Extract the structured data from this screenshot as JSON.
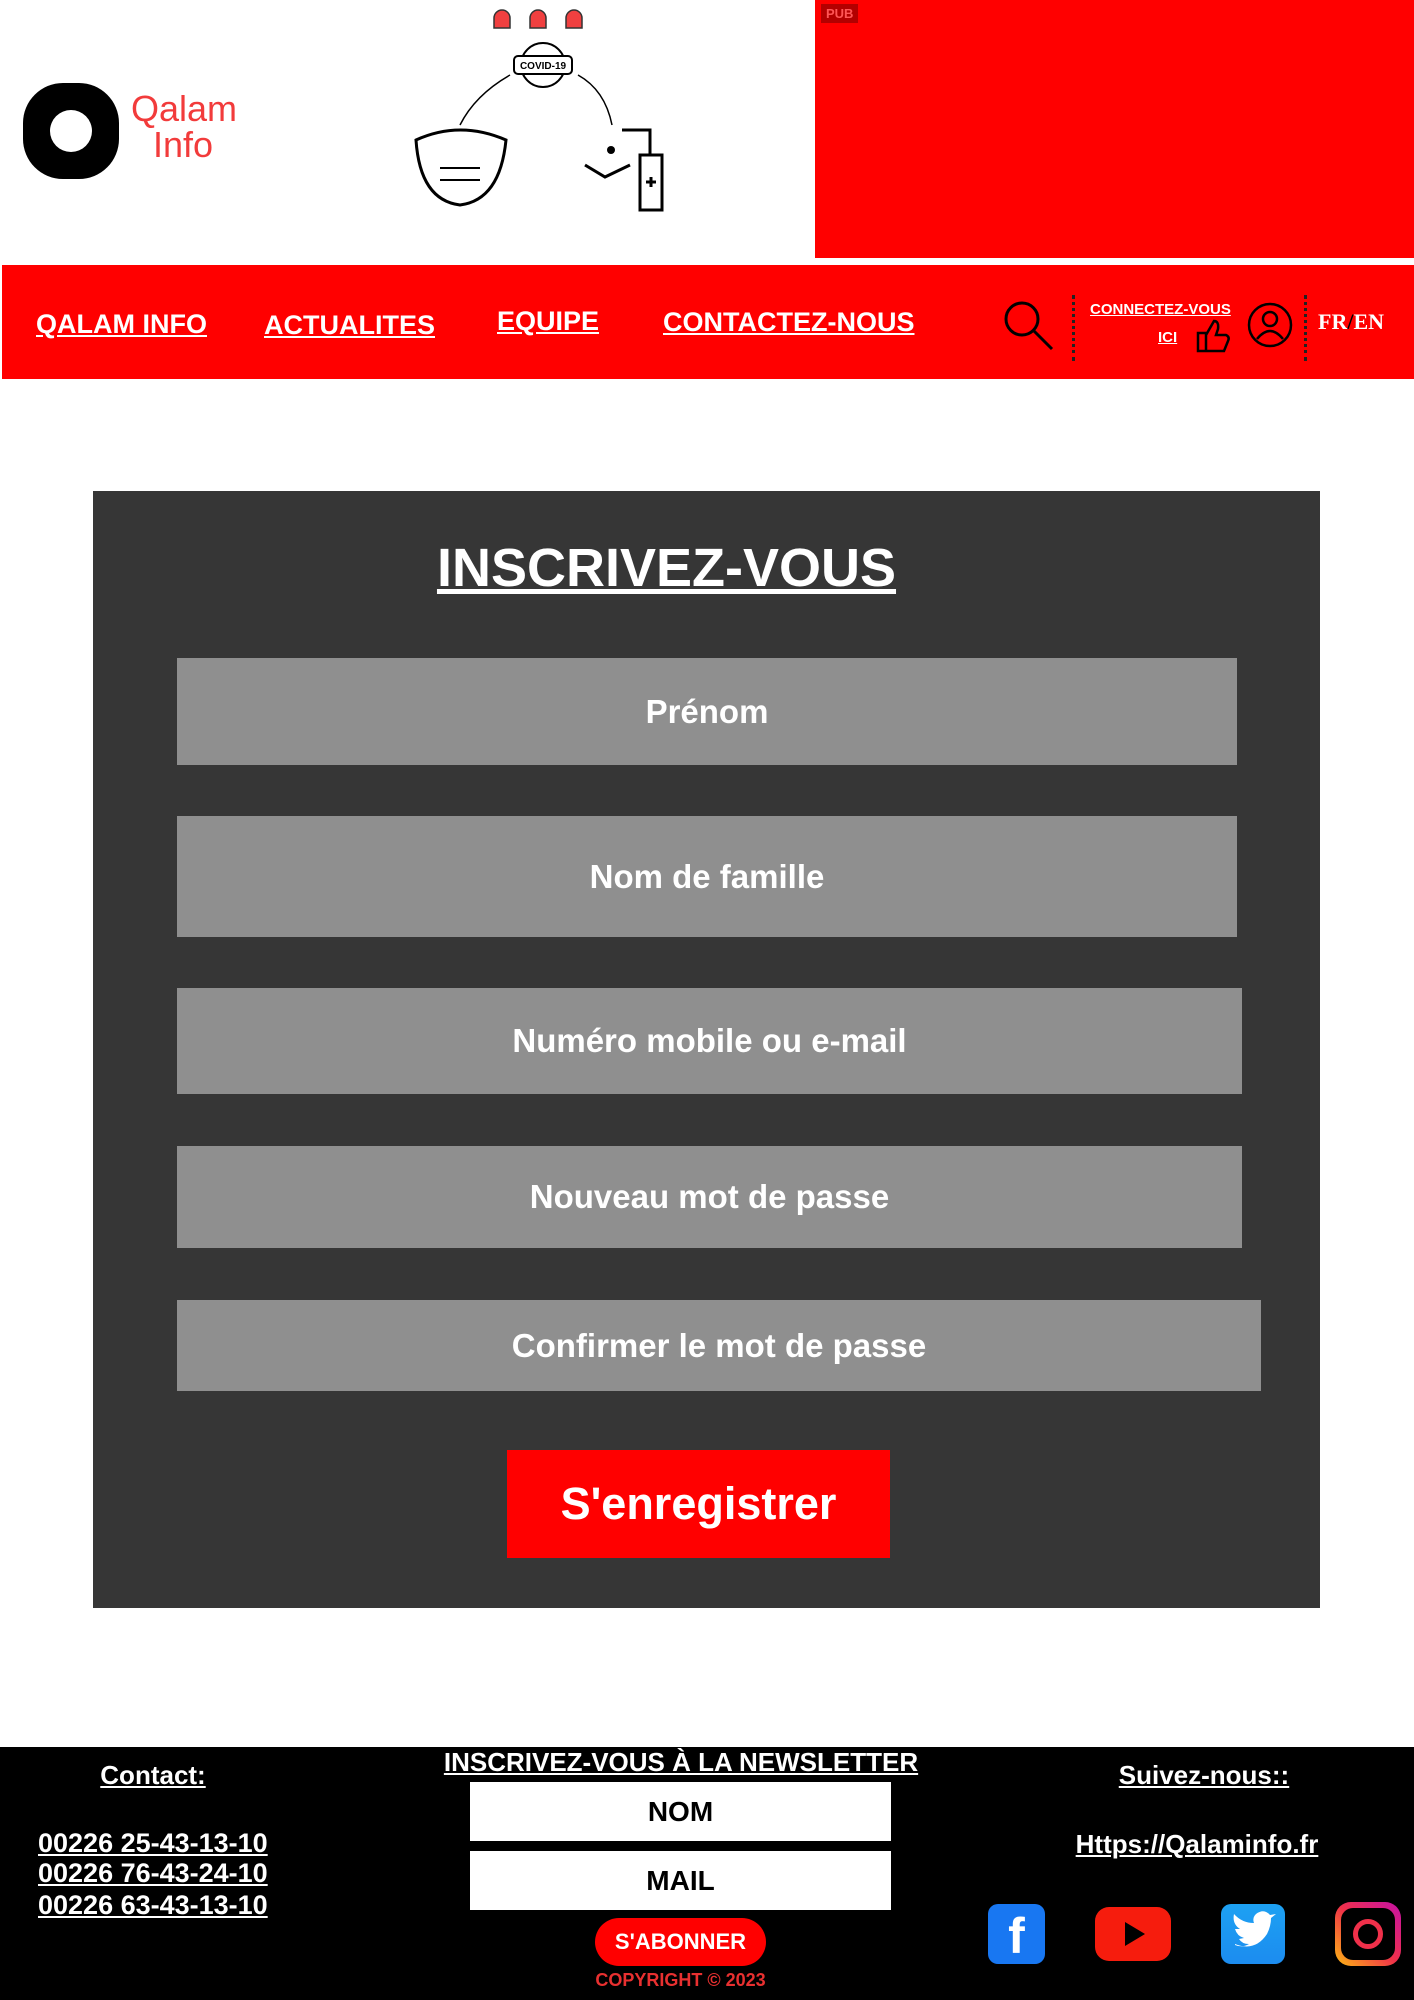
{
  "header": {
    "logo_text_line1": "Qalam",
    "logo_text_line2": "Info",
    "covid_label": "COVID-19",
    "pub_label": "PUB"
  },
  "nav": {
    "items": [
      {
        "label": "QALAM INFO"
      },
      {
        "label": "ACTUALITES"
      },
      {
        "label": "EQUIPE"
      },
      {
        "label": "CONTACTEZ-NOUS"
      }
    ],
    "connect_line1": "CONNECTEZ-VOUS",
    "connect_line2": "ICI",
    "lang_fr": "FR",
    "lang_sep": "/",
    "lang_en": "EN"
  },
  "form": {
    "title": "INSCRIVEZ-VOUS",
    "fields": [
      {
        "placeholder": "Prénom"
      },
      {
        "placeholder": "Nom de famille"
      },
      {
        "placeholder": "Numéro  mobile ou e-mail"
      },
      {
        "placeholder": "Nouveau mot de passe"
      },
      {
        "placeholder": "Confirmer le mot de passe"
      }
    ],
    "submit_label": "S'enregistrer"
  },
  "footer": {
    "contact_heading": "Contact:",
    "phones": [
      "00226 25-43-13-10",
      "00226 76-43-24-10",
      "00226 63-43-13-10"
    ],
    "newsletter_heading": "INSCRIVEZ-VOUS À LA NEWSLETTER",
    "nom_placeholder": "NOM",
    "mail_placeholder": "MAIL",
    "subscribe_label": "S'ABONNER",
    "copyright": "COPYRIGHT © 2023",
    "follow_heading": "Suivez-nous::",
    "website": "Https://Qalaminfo.fr",
    "colors": {
      "facebook": "#1877f2",
      "youtube": "#f61c0d",
      "twitter": "#1da1f2"
    }
  }
}
